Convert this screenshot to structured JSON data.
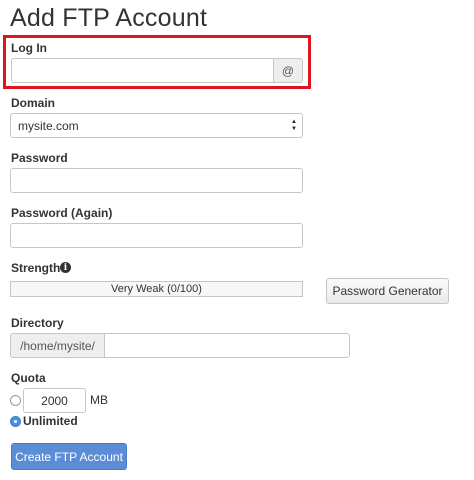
{
  "page": {
    "title": "Add FTP Account"
  },
  "login": {
    "label": "Log In",
    "value": "",
    "addon": "@"
  },
  "domain": {
    "label": "Domain",
    "selected": "mysite.com"
  },
  "password": {
    "label": "Password",
    "value": ""
  },
  "password_again": {
    "label": "Password (Again)",
    "value": ""
  },
  "strength": {
    "label": "Strength",
    "info_icon": "info-icon",
    "value_text": "Very Weak (0/100)",
    "score": 0,
    "generator_button": "Password Generator"
  },
  "directory": {
    "label": "Directory",
    "prefix": "/home/mysite/",
    "value": ""
  },
  "quota": {
    "label": "Quota",
    "limited_value": "2000",
    "unit": "MB",
    "unlimited_label": "Unlimited",
    "selected": "Unlimited"
  },
  "submit": {
    "label": "Create FTP Account"
  },
  "colors": {
    "highlight": "#e0141e",
    "primary_button": "#5b8dd6",
    "radio_selected": "#4a90e2"
  }
}
